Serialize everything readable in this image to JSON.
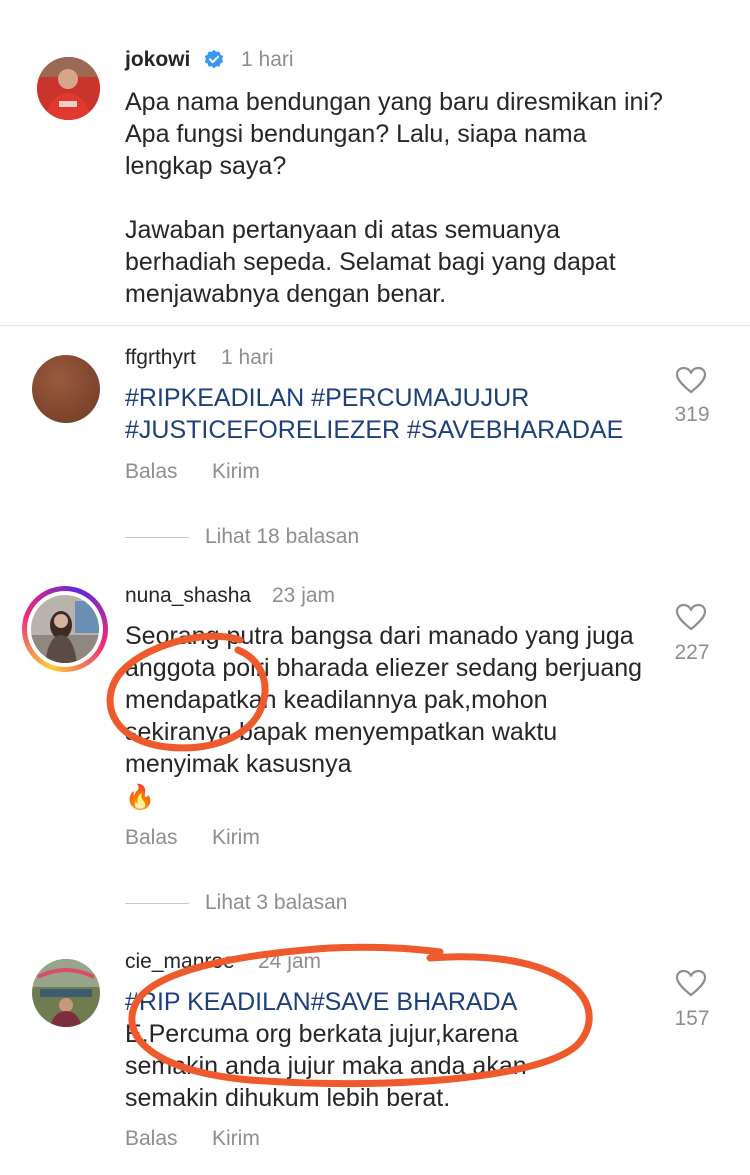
{
  "caption": {
    "username": "jokowi",
    "time": "1 hari",
    "text": "Apa nama bendungan yang baru diresmikan ini? Apa fungsi bendungan? Lalu, siapa nama lengkap saya?\n\nJawaban pertanyaan di atas semuanya berhadiah sepeda. Selamat bagi yang dapat menjawabnya dengan benar."
  },
  "comments": [
    {
      "username": "ffgrthyrt",
      "time": "1 hari",
      "text": "#RIPKEADILAN #PERCUMAJUJUR #JUSTICEFORELIEZER #SAVEBHARADAE",
      "likes": "319",
      "reply_label": "Balas",
      "send_label": "Kirim",
      "view_replies": "Lihat 18 balasan"
    },
    {
      "username": "nuna_shasha",
      "time": "23 jam",
      "text": "Seorang putra bangsa dari manado yang juga anggota polri bharada eliezer sedang berjuang mendapatkan keadilannya pak,mohon sekiranya bapak menyempatkan waktu menyimak kasusnya",
      "emoji": "🔥",
      "likes": "227",
      "reply_label": "Balas",
      "send_label": "Kirim",
      "view_replies": "Lihat 3 balasan"
    },
    {
      "username": "cie_manroe",
      "time": "24 jam",
      "hashtag_line": "#RIP KEADILAN#SAVE BHARADA",
      "text": "E.Percuma org berkata jujur,karena semakin anda jujur maka anda akan semakin dihukum lebih berat.",
      "likes": "157",
      "reply_label": "Balas",
      "send_label": "Kirim"
    }
  ],
  "icons": {
    "verified": "verified-badge-icon",
    "like": "heart-icon"
  },
  "colors": {
    "verified_blue": "#3897f0",
    "hashtag": "#1d3f7a",
    "annotation": "#ee5a2c",
    "secondary_text": "#8e8e8e"
  }
}
